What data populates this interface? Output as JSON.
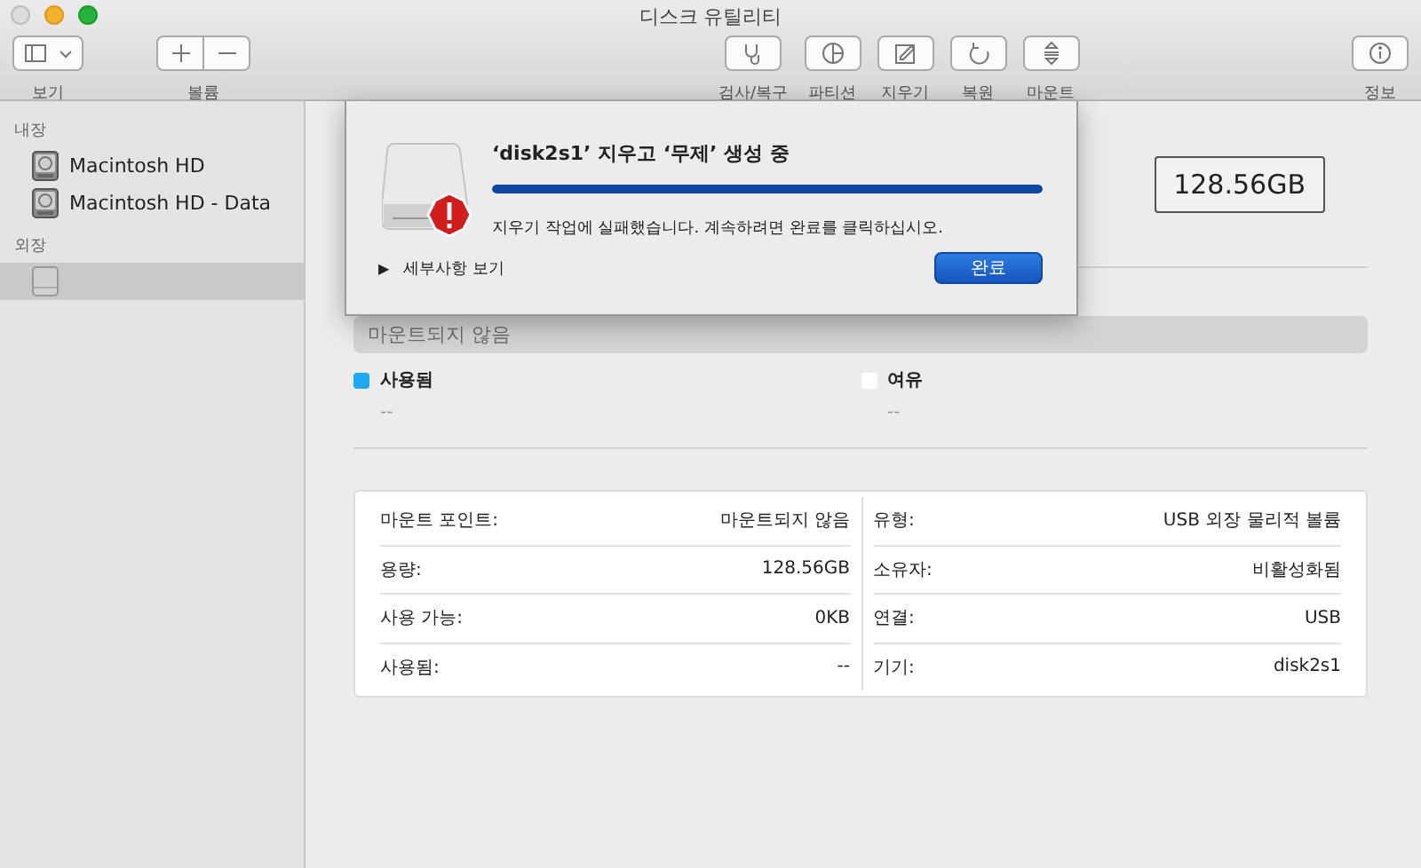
{
  "window": {
    "title": "디스크 유틸리티"
  },
  "toolbar": {
    "left": [
      {
        "kind": "view",
        "label": "보기"
      },
      {
        "kind": "volume",
        "label": "볼륨"
      }
    ],
    "center": [
      {
        "kind": "firstaid",
        "label": "검사/복구"
      },
      {
        "kind": "partition",
        "label": "파티션"
      },
      {
        "kind": "erase",
        "label": "지우기"
      },
      {
        "kind": "restore",
        "label": "복원"
      },
      {
        "kind": "mount",
        "label": "마운트"
      }
    ],
    "right": [
      {
        "kind": "info",
        "label": "정보"
      }
    ]
  },
  "sidebar": {
    "sections": [
      {
        "title": "내장",
        "items": [
          {
            "label": "Macintosh HD",
            "kind": "internal",
            "selected": false
          },
          {
            "label": "Macintosh HD - Data",
            "kind": "internal",
            "selected": false
          }
        ]
      },
      {
        "title": "외장",
        "items": [
          {
            "kind": "external",
            "selected": true
          }
        ]
      }
    ]
  },
  "dialog": {
    "title": "‘disk2s1’ 지우고 ‘무제’ 생성 중",
    "level": 1,
    "message": "지우기 작업에 실패했습니다. 계속하려면 완료를 클릭하십시오.",
    "details": {
      "arrow": "▶",
      "label": "세부사항 보기"
    },
    "button": "완료"
  },
  "capacity": "128.56GB",
  "usage_bar": {
    "label": "마운트되지 않음"
  },
  "legend": [
    {
      "label": "사용됨",
      "color": "#1eaaf1",
      "value": "--"
    },
    {
      "label": "여유",
      "color": "#ffffff",
      "value": "--"
    }
  ],
  "info": {
    "left": [
      {
        "label": "마운트 포인트:",
        "value": "마운트되지 않음"
      },
      {
        "label": "용량:",
        "value": "128.56GB"
      },
      {
        "label": "사용 가능:",
        "value": "0KB"
      },
      {
        "label": "사용됨:",
        "value": "--"
      }
    ],
    "right": [
      {
        "label": "유형:",
        "value": "USB 외장 물리적 볼륨"
      },
      {
        "label": "소유자:",
        "value": "비활성화됨"
      },
      {
        "label": "연결:",
        "value": "USB"
      },
      {
        "label": "기기:",
        "value": "disk2s1"
      }
    ]
  }
}
